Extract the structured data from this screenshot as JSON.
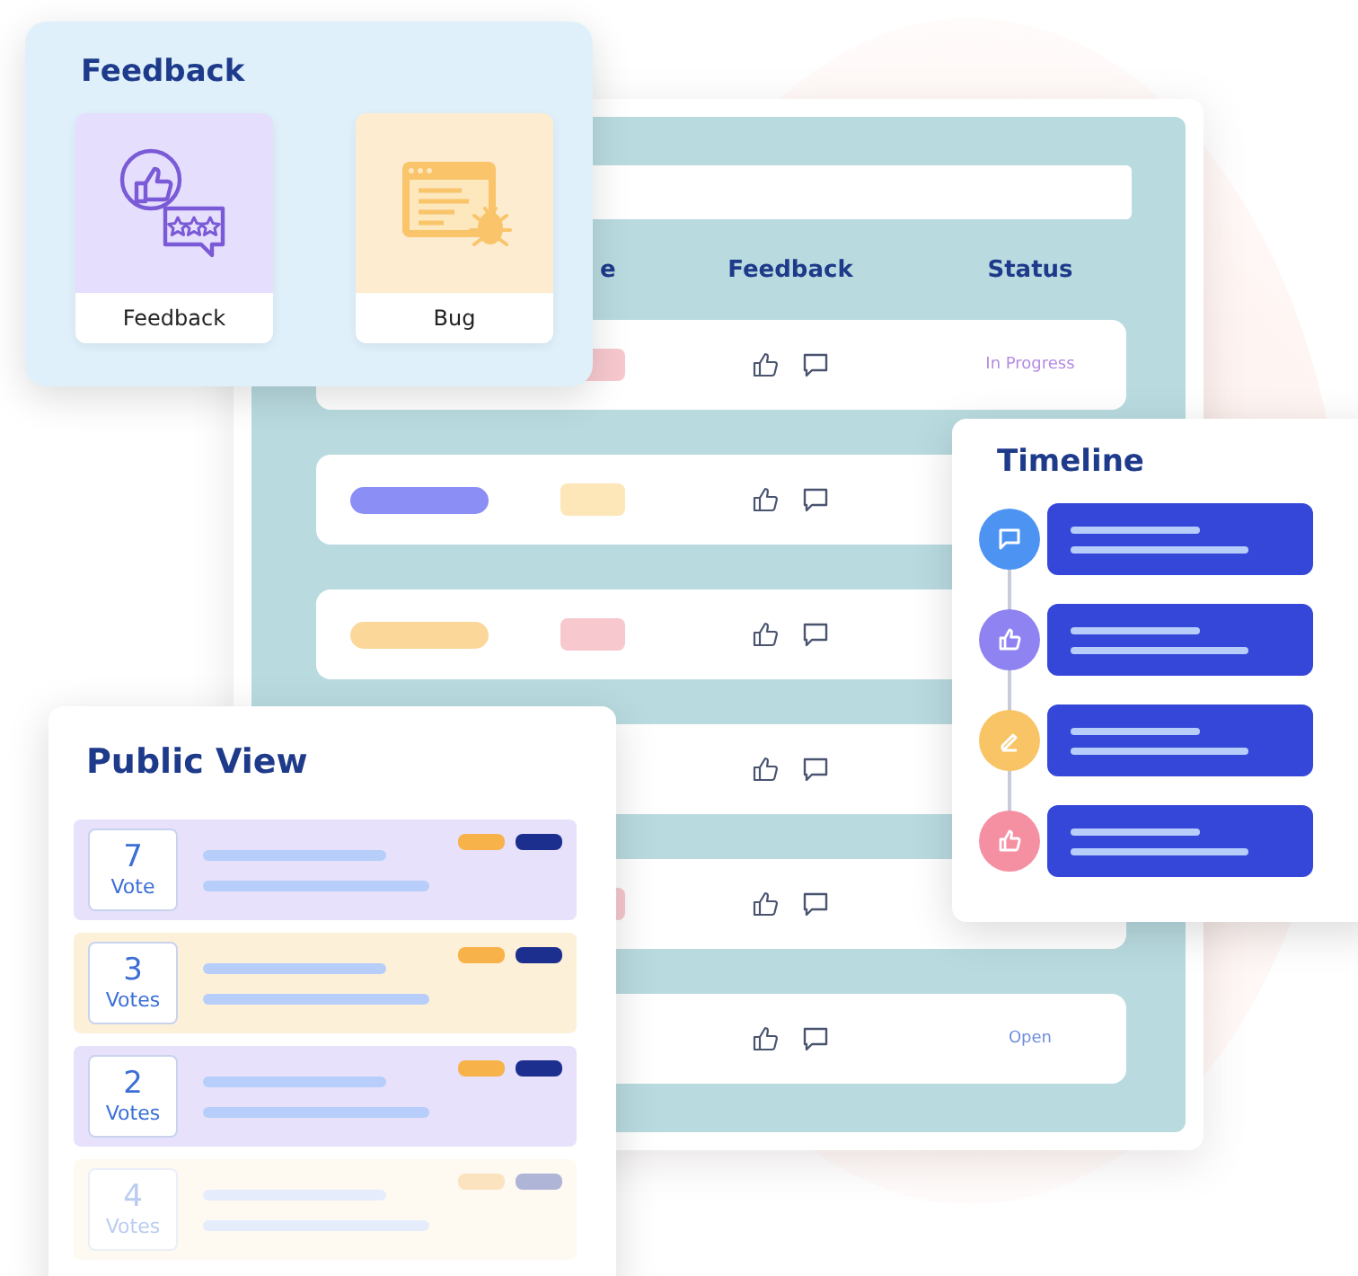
{
  "board": {
    "columns": [
      "e",
      "Feedback",
      "Status"
    ],
    "rows": [
      {
        "tag": {
          "color": "#f7c9cf"
        },
        "status": {
          "text": "In Progress",
          "color": "#b58be0"
        }
      },
      {
        "name": {
          "color": "#8b8ff5"
        },
        "tag": {
          "color": "#fde6b8"
        }
      },
      {
        "name": {
          "color": "#fbd79a"
        },
        "tag": {
          "color": "#f7c9cf"
        }
      },
      {},
      {
        "tag": {
          "color": "#f7c9cf"
        }
      },
      {
        "status": {
          "text": "Open",
          "color": "#6f8fdc"
        }
      }
    ]
  },
  "feedback_panel": {
    "title": "Feedback",
    "tiles": [
      {
        "label": "Feedback",
        "kind": "review"
      },
      {
        "label": "Bug",
        "kind": "bug"
      }
    ]
  },
  "timeline": {
    "title": "Timeline",
    "entries": [
      {
        "kind": "comment",
        "color": "#4d94f2"
      },
      {
        "kind": "like",
        "color": "#8f83f2"
      },
      {
        "kind": "edit",
        "color": "#f8c466"
      },
      {
        "kind": "like",
        "color": "#f590a3"
      }
    ]
  },
  "public_view": {
    "title": "Public View",
    "items": [
      {
        "count": "7",
        "unit": "Vote",
        "color": "#e7e1fb",
        "faded": false
      },
      {
        "count": "3",
        "unit": "Votes",
        "color": "#fdf0d9",
        "faded": false
      },
      {
        "count": "2",
        "unit": "Votes",
        "color": "#e7e1fb",
        "faded": false
      },
      {
        "count": "4",
        "unit": "Votes",
        "color": "#fdf0d9",
        "faded": true
      }
    ]
  }
}
